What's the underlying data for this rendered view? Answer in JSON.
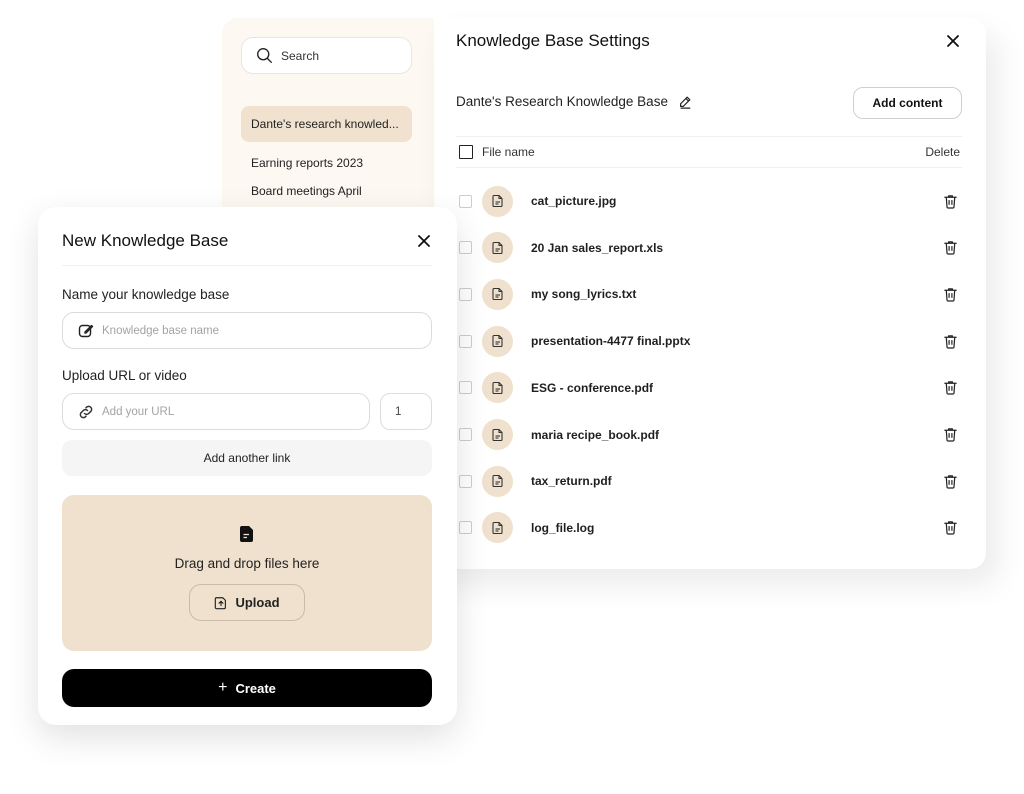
{
  "sidebar": {
    "search_label": "Search",
    "items": [
      {
        "label": "Dante's research knowled...",
        "active": true
      },
      {
        "label": "Earning reports 2023",
        "active": false
      },
      {
        "label": "Board meetings April",
        "active": false
      }
    ]
  },
  "settings": {
    "title": "Knowledge Base Settings",
    "kb_name": "Dante's Research Knowledge Base",
    "add_content_label": "Add content",
    "columns": {
      "file_name": "File name",
      "delete": "Delete"
    },
    "files": [
      {
        "name": "cat_picture.jpg"
      },
      {
        "name": "20 Jan sales_report.xls"
      },
      {
        "name": "my song_lyrics.txt"
      },
      {
        "name": "presentation-4477 final.pptx"
      },
      {
        "name": "ESG - conference.pdf"
      },
      {
        "name": "maria recipe_book.pdf"
      },
      {
        "name": "tax_return.pdf"
      },
      {
        "name": "log_file.log"
      }
    ]
  },
  "new_kb": {
    "title": "New Knowledge Base",
    "name_label": "Name your knowledge base",
    "name_placeholder": "Knowledge base name",
    "url_label": "Upload URL or video",
    "url_placeholder": "Add your URL",
    "url_count": "1",
    "add_link_label": "Add another link",
    "drop_text": "Drag and drop files here",
    "upload_label": "Upload",
    "create_label": "Create"
  },
  "colors": {
    "accent_beige": "#efe1cd",
    "sidebar_bg": "#fdf8f1",
    "primary_button": "#000000"
  }
}
